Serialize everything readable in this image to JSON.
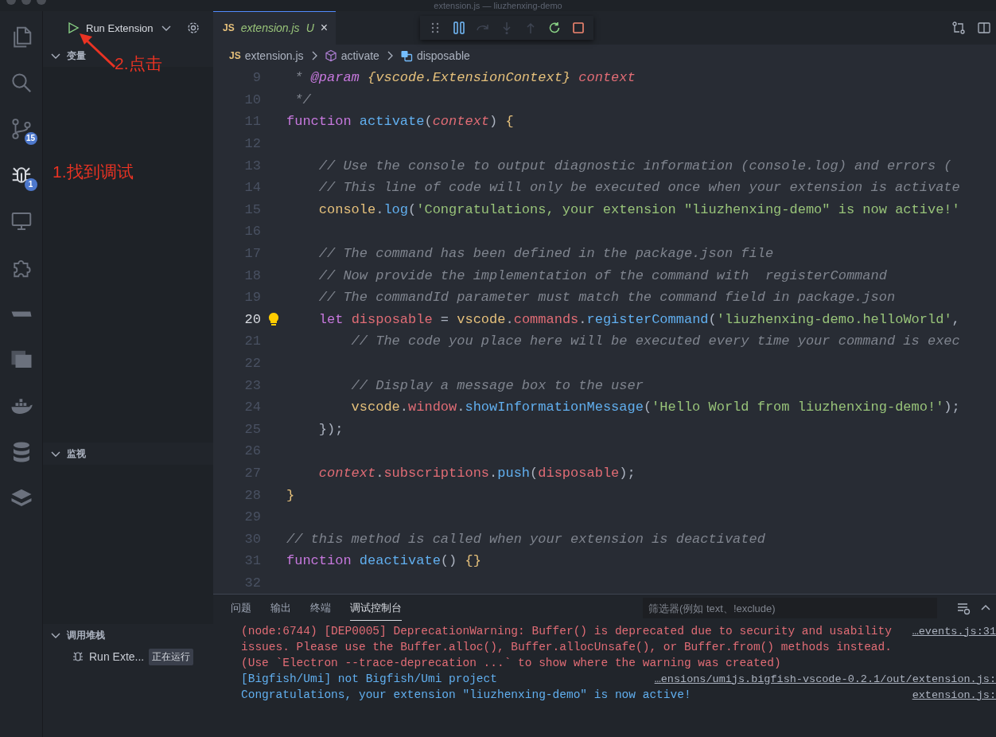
{
  "window": {
    "title": "extension.js — liuzhenxing-demo"
  },
  "activity_bar": {
    "items": [
      {
        "kind": "files",
        "selected": false
      },
      {
        "kind": "search",
        "selected": false
      },
      {
        "kind": "branch",
        "selected": false,
        "badge": "15"
      },
      {
        "kind": "bug",
        "selected": true,
        "badge": "1"
      },
      {
        "kind": "monitor",
        "selected": false
      },
      {
        "kind": "puzzle",
        "selected": false
      },
      {
        "kind": "shape",
        "selected": false
      },
      {
        "kind": "panel",
        "selected": false
      },
      {
        "kind": "whale",
        "selected": false
      },
      {
        "kind": "database",
        "selected": false
      },
      {
        "kind": "stack",
        "selected": false
      }
    ]
  },
  "sidebar": {
    "run_config": "Run Extension",
    "sections": [
      {
        "title": "变量",
        "expanded": true
      },
      {
        "title": "监视",
        "expanded": true
      },
      {
        "title": "调用堆栈",
        "expanded": true,
        "items": [
          {
            "label": "Run Exte...",
            "status": "正在运行"
          }
        ]
      }
    ]
  },
  "editor": {
    "tabs": [
      {
        "icon": "JS",
        "label": "extension.js",
        "status": "U",
        "close": "×",
        "selected": true
      }
    ],
    "breadcrumb": {
      "file_icon": "JS",
      "file": "extension.js",
      "symbols": [
        "activate",
        "disposable"
      ]
    },
    "lines": [
      {
        "number": "9",
        "current": false,
        "tokens": [
          {
            "kind": "comment",
            "text": " * "
          },
          {
            "kind": "doctag",
            "text": "@param"
          },
          {
            "kind": "doctype",
            "text": " {vscode.ExtensionContext}"
          },
          {
            "kind": "docparam",
            "text": " context"
          }
        ]
      },
      {
        "number": "10",
        "current": false,
        "tokens": [
          {
            "kind": "comment",
            "text": " */"
          }
        ]
      },
      {
        "number": "11",
        "current": false,
        "tokens": [
          {
            "kind": "keyword",
            "text": "function "
          },
          {
            "kind": "function",
            "text": "activate"
          },
          {
            "kind": "plain",
            "text": "("
          },
          {
            "kind": "param",
            "text": "context"
          },
          {
            "kind": "plain",
            "text": ") "
          },
          {
            "kind": "brace",
            "text": "{"
          }
        ]
      },
      {
        "number": "12",
        "current": false
      },
      {
        "number": "13",
        "current": false,
        "tokens": [
          {
            "kind": "comment",
            "text": "    // Use the console to output diagnostic information (console.log) and errors ("
          }
        ]
      },
      {
        "number": "14",
        "current": false,
        "tokens": [
          {
            "kind": "comment",
            "text": "    // This line of code will only be executed once when your extension is activate"
          }
        ]
      },
      {
        "number": "15",
        "current": false,
        "tokens": [
          {
            "kind": "object",
            "text": "    console"
          },
          {
            "kind": "plain",
            "text": "."
          },
          {
            "kind": "function",
            "text": "log"
          },
          {
            "kind": "plain",
            "text": "("
          },
          {
            "kind": "string",
            "text": "'Congratulations, your extension \"liuzhenxing-demo\" is now active!'"
          }
        ]
      },
      {
        "number": "16",
        "current": false
      },
      {
        "number": "17",
        "current": false,
        "tokens": [
          {
            "kind": "comment",
            "text": "    // The command has been defined in the package.json file"
          }
        ]
      },
      {
        "number": "18",
        "current": false,
        "tokens": [
          {
            "kind": "comment",
            "text": "    // Now provide the implementation of the command with  registerCommand"
          }
        ]
      },
      {
        "number": "19",
        "current": false,
        "tokens": [
          {
            "kind": "comment",
            "text": "    // The commandId parameter must match the command field in package.json"
          }
        ]
      },
      {
        "number": "20",
        "current": true,
        "tokens": [
          {
            "kind": "keyword",
            "text": "    let "
          },
          {
            "kind": "variable",
            "text": "disposable"
          },
          {
            "kind": "plain",
            "text": " = "
          },
          {
            "kind": "object",
            "text": "vscode"
          },
          {
            "kind": "plain",
            "text": "."
          },
          {
            "kind": "variable",
            "text": "commands"
          },
          {
            "kind": "plain",
            "text": "."
          },
          {
            "kind": "function",
            "text": "registerCommand"
          },
          {
            "kind": "plain",
            "text": "("
          },
          {
            "kind": "string",
            "text": "'liuzhenxing-demo.helloWorld'"
          },
          {
            "kind": "plain",
            "text": ","
          }
        ]
      },
      {
        "number": "21",
        "current": false,
        "tokens": [
          {
            "kind": "comment",
            "text": "        // The code you place here will be executed every time your command is exec"
          }
        ]
      },
      {
        "number": "22",
        "current": false
      },
      {
        "number": "23",
        "current": false,
        "tokens": [
          {
            "kind": "comment",
            "text": "        // Display a message box to the user"
          }
        ]
      },
      {
        "number": "24",
        "current": false,
        "tokens": [
          {
            "kind": "object",
            "text": "        vscode"
          },
          {
            "kind": "plain",
            "text": "."
          },
          {
            "kind": "variable",
            "text": "window"
          },
          {
            "kind": "plain",
            "text": "."
          },
          {
            "kind": "function",
            "text": "showInformationMessage"
          },
          {
            "kind": "plain",
            "text": "("
          },
          {
            "kind": "string",
            "text": "'Hello World from liuzhenxing-demo!'"
          },
          {
            "kind": "plain",
            "text": ");"
          }
        ]
      },
      {
        "number": "25",
        "current": false,
        "tokens": [
          {
            "kind": "plain",
            "text": "    });"
          }
        ]
      },
      {
        "number": "26",
        "current": false
      },
      {
        "number": "27",
        "current": false,
        "tokens": [
          {
            "kind": "param",
            "text": "    context"
          },
          {
            "kind": "plain",
            "text": "."
          },
          {
            "kind": "variable",
            "text": "subscriptions"
          },
          {
            "kind": "plain",
            "text": "."
          },
          {
            "kind": "function",
            "text": "push"
          },
          {
            "kind": "plain",
            "text": "("
          },
          {
            "kind": "variable",
            "text": "disposable"
          },
          {
            "kind": "plain",
            "text": ");"
          }
        ]
      },
      {
        "number": "28",
        "current": false,
        "tokens": [
          {
            "kind": "brace",
            "text": "}"
          }
        ]
      },
      {
        "number": "29",
        "current": false
      },
      {
        "number": "30",
        "current": false,
        "tokens": [
          {
            "kind": "comment",
            "text": "// this method is called when your extension is deactivated"
          }
        ]
      },
      {
        "number": "31",
        "current": false,
        "tokens": [
          {
            "kind": "keyword",
            "text": "function "
          },
          {
            "kind": "function",
            "text": "deactivate"
          },
          {
            "kind": "plain",
            "text": "() "
          },
          {
            "kind": "brace",
            "text": "{}"
          }
        ]
      },
      {
        "number": "32",
        "current": false
      }
    ]
  },
  "panel": {
    "tabs": [
      {
        "label": "问题",
        "selected": false
      },
      {
        "label": "输出",
        "selected": false
      },
      {
        "label": "终端",
        "selected": false
      },
      {
        "label": "调试控制台",
        "selected": true
      }
    ],
    "filter": {
      "placeholder": "筛选器(例如 text、!exclude)"
    },
    "console": [
      {
        "kind": "warning",
        "text": "(node:6744) [DEP0005] DeprecationWarning: Buffer() is deprecated due to security and usability",
        "source": "…events.js:31"
      },
      {
        "kind": "warning",
        "text": "issues. Please use the Buffer.alloc(), Buffer.allocUnsafe(), or Buffer.from() methods instead."
      },
      {
        "kind": "warning",
        "text": "(Use `Electron --trace-deprecation ...` to show where the warning was created)"
      },
      {
        "kind": "info",
        "text": "[Bigfish/Umi] not Bigfish/Umi project",
        "source": "…ensions/umijs.bigfish-vscode-0.2.1/out/extension.js:"
      },
      {
        "kind": "info",
        "text": "Congratulations, your extension \"liuzhenxing-demo\" is now active!",
        "source": "extension.js:"
      }
    ]
  },
  "annotations": [
    {
      "text": "2.点击"
    },
    {
      "text": "1.找到调试"
    }
  ]
}
